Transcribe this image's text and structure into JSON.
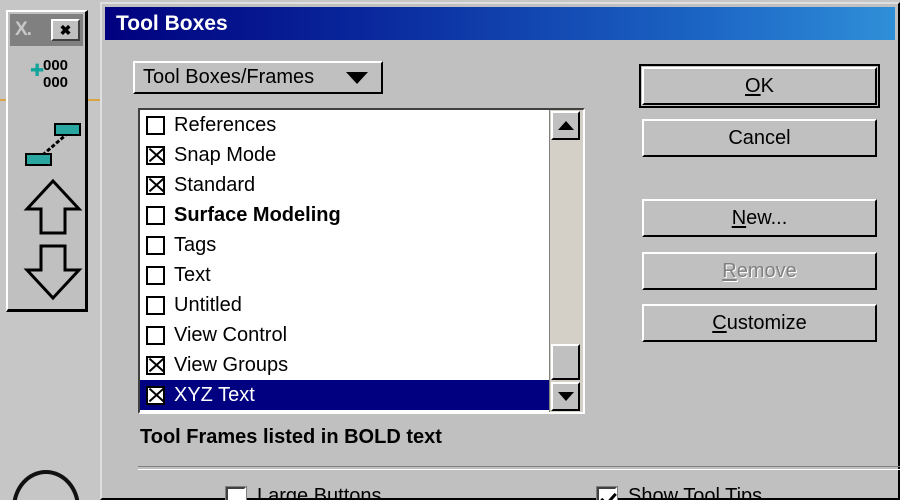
{
  "background": {
    "arc_name": "cad-arc-fragment",
    "rule_color": "#d9a441"
  },
  "palette": {
    "title": "X.",
    "close_label": "✖",
    "tools": [
      {
        "name": "coordinate-readout-tool",
        "line1": "000",
        "line2": "000",
        "color": "#12a39a"
      },
      {
        "name": "line-between-points-tool",
        "color": "#12a39a"
      },
      {
        "name": "move-up-tool"
      },
      {
        "name": "move-down-tool"
      }
    ]
  },
  "dialog": {
    "title": "Tool Boxes",
    "combo": {
      "value": "Tool Boxes/Frames",
      "arrow_icon": "chevron-down-icon"
    },
    "list": {
      "items": [
        {
          "label": "References",
          "checked": false,
          "bold": false,
          "selected": false
        },
        {
          "label": "Snap Mode",
          "checked": true,
          "bold": false,
          "selected": false
        },
        {
          "label": "Standard",
          "checked": true,
          "bold": false,
          "selected": false
        },
        {
          "label": "Surface Modeling",
          "checked": false,
          "bold": true,
          "selected": false
        },
        {
          "label": "Tags",
          "checked": false,
          "bold": false,
          "selected": false
        },
        {
          "label": "Text",
          "checked": false,
          "bold": false,
          "selected": false
        },
        {
          "label": "Untitled",
          "checked": false,
          "bold": false,
          "selected": false
        },
        {
          "label": "View Control",
          "checked": false,
          "bold": false,
          "selected": false
        },
        {
          "label": "View Groups",
          "checked": true,
          "bold": false,
          "selected": false
        },
        {
          "label": "XYZ Text",
          "checked": true,
          "bold": false,
          "selected": true
        }
      ],
      "scrollbar": {
        "up_icon": "triangle-up-icon",
        "down_icon": "triangle-down-icon",
        "position": "bottom"
      }
    },
    "note": "Tool Frames listed in BOLD text",
    "options": [
      {
        "label": "Large Buttons",
        "checked": false
      },
      {
        "label": "Show Tool Tips",
        "checked": true
      }
    ],
    "buttons": [
      {
        "label": "OK",
        "accel": "O",
        "default": true,
        "disabled": false
      },
      {
        "label": "Cancel",
        "accel": "",
        "default": false,
        "disabled": false
      },
      {
        "label": "New...",
        "accel": "N",
        "default": false,
        "disabled": false
      },
      {
        "label": "Remove",
        "accel": "R",
        "default": false,
        "disabled": true
      },
      {
        "label": "Customize",
        "accel": "C",
        "default": false,
        "disabled": false
      }
    ]
  },
  "colors": {
    "titlebar_start": "#00007e",
    "titlebar_end": "#2f8fd8",
    "selection": "#000080",
    "face": "#c0c0c0",
    "accent_teal": "#12a39a"
  }
}
